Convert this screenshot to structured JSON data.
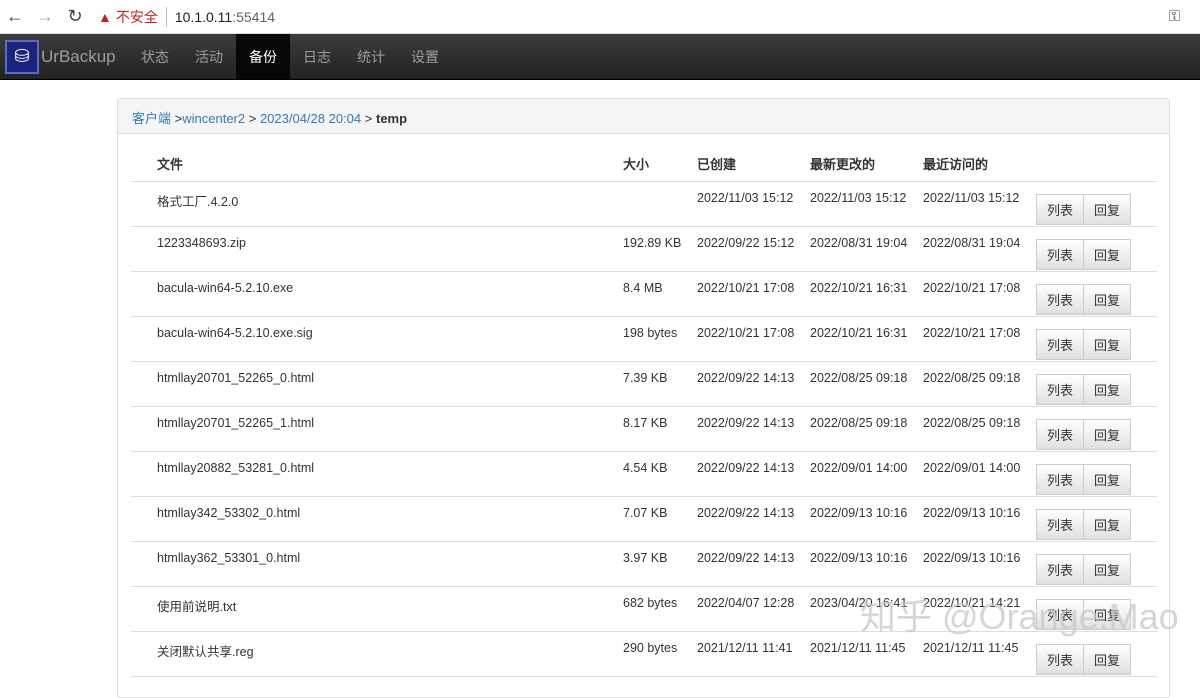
{
  "browser": {
    "insecure_label": "不安全",
    "host": "10.1.0.11",
    "port": ":55414"
  },
  "navbar": {
    "brand": "UrBackup",
    "items": [
      {
        "label": "状态"
      },
      {
        "label": "活动"
      },
      {
        "label": "备份",
        "active": true
      },
      {
        "label": "日志"
      },
      {
        "label": "统计"
      },
      {
        "label": "设置"
      }
    ]
  },
  "breadcrumb": {
    "clients": "客户端",
    "sep1": " >",
    "client": "wincenter2",
    "sep2": " > ",
    "backup": "2023/04/28 20:04",
    "sep3": " > ",
    "current": "temp"
  },
  "table": {
    "headers": [
      "文件",
      "大小",
      "已创建",
      "最新更改的",
      "最近访问的"
    ],
    "list_label": "列表",
    "restore_label": "回复",
    "rows": [
      [
        "格式工厂.4.2.0",
        "",
        "2022/11/03 15:12",
        "2022/11/03 15:12",
        "2022/11/03 15:12"
      ],
      [
        "1223348693.zip",
        "192.89 KB",
        "2022/09/22 15:12",
        "2022/08/31 19:04",
        "2022/08/31 19:04"
      ],
      [
        "bacula-win64-5.2.10.exe",
        "8.4 MB",
        "2022/10/21 17:08",
        "2022/10/21 16:31",
        "2022/10/21 17:08"
      ],
      [
        "bacula-win64-5.2.10.exe.sig",
        "198 bytes",
        "2022/10/21 17:08",
        "2022/10/21 16:31",
        "2022/10/21 17:08"
      ],
      [
        "htmllay20701_52265_0.html",
        "7.39 KB",
        "2022/09/22 14:13",
        "2022/08/25 09:18",
        "2022/08/25 09:18"
      ],
      [
        "htmllay20701_52265_1.html",
        "8.17 KB",
        "2022/09/22 14:13",
        "2022/08/25 09:18",
        "2022/08/25 09:18"
      ],
      [
        "htmllay20882_53281_0.html",
        "4.54 KB",
        "2022/09/22 14:13",
        "2022/09/01 14:00",
        "2022/09/01 14:00"
      ],
      [
        "htmllay342_53302_0.html",
        "7.07 KB",
        "2022/09/22 14:13",
        "2022/09/13 10:16",
        "2022/09/13 10:16"
      ],
      [
        "htmllay362_53301_0.html",
        "3.97 KB",
        "2022/09/22 14:13",
        "2022/09/13 10:16",
        "2022/09/13 10:16"
      ],
      [
        "使用前说明.txt",
        "682 bytes",
        "2022/04/07 12:28",
        "2023/04/20 16:41",
        "2022/10/21 14:21"
      ],
      [
        "关闭默认共享.reg",
        "290 bytes",
        "2021/12/11 11:41",
        "2021/12/11 11:45",
        "2021/12/11 11:45"
      ]
    ]
  },
  "watermark": "知乎 @Orange.Mao"
}
